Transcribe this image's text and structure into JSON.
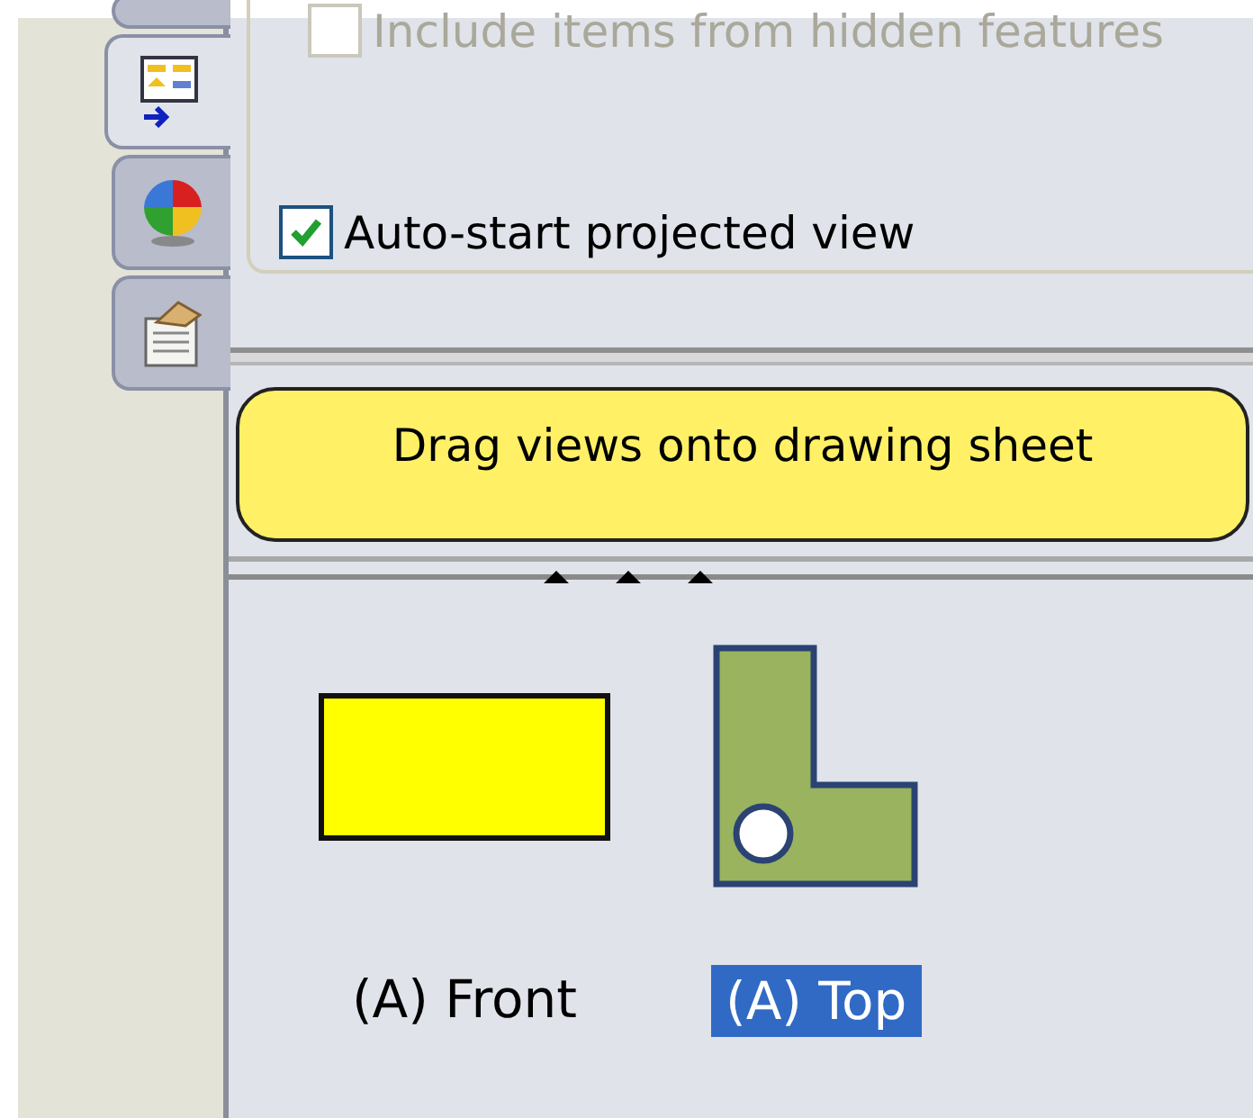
{
  "tabs": [
    {
      "selected": false
    },
    {
      "selected": true
    },
    {
      "selected": false
    },
    {
      "selected": false
    }
  ],
  "options": [
    {
      "label": "Include items from hidden features",
      "checked": false,
      "disabled": true
    },
    {
      "label": "Auto-start projected view",
      "checked": true,
      "disabled": false
    }
  ],
  "message": "Drag views onto drawing sheet",
  "views": [
    {
      "label": "(A) Front",
      "selected": false
    },
    {
      "label": "(A) Top",
      "selected": true
    }
  ]
}
